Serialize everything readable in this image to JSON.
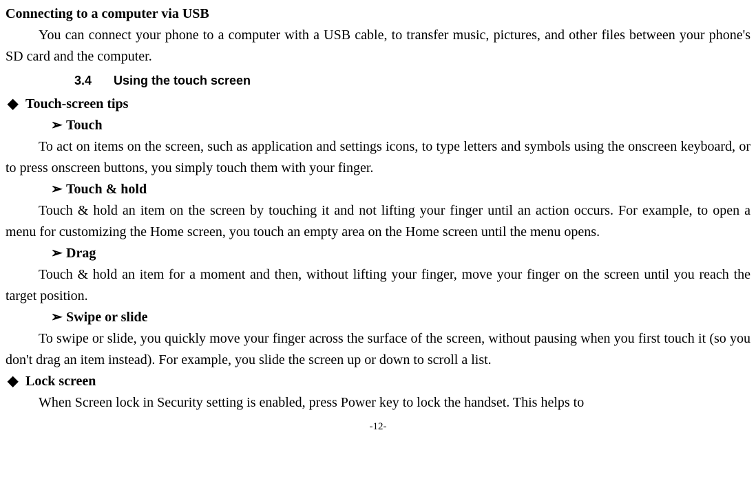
{
  "h_usb": "Connecting to a computer via USB",
  "p_usb": "You can connect your phone to a computer with a USB cable, to transfer music, pictures, and other files between your phone's SD card and the computer.",
  "sec_num": "3.4",
  "sec_title": "Using the touch screen",
  "d_tips": "Touch-screen tips",
  "a_touch": "Touch",
  "p_touch": "To act on items on the screen, such as application and settings icons, to type letters and symbols using the onscreen keyboard, or to press onscreen buttons, you simply touch them with your finger.",
  "a_touchhold": "Touch & hold",
  "p_touchhold": "Touch & hold an item on the screen by touching it and not lifting your finger until an action occurs. For example, to open a menu for customizing the Home screen, you touch an empty area on the Home screen until the menu opens.",
  "a_drag": "Drag",
  "p_drag": "Touch & hold an item for a moment and then, without lifting your finger, move your finger on the screen until you reach the target position.",
  "a_swipe": "Swipe or slide",
  "p_swipe": "To swipe or slide, you quickly move your finger across the surface of the screen, without pausing when you first touch it (so you don't drag an item instead). For example, you slide the screen up or down to scroll a list.",
  "d_lock": "Lock screen",
  "p_lock": "When Screen lock in Security setting is enabled, press Power key to lock the handset. This helps to",
  "page": "-12-"
}
